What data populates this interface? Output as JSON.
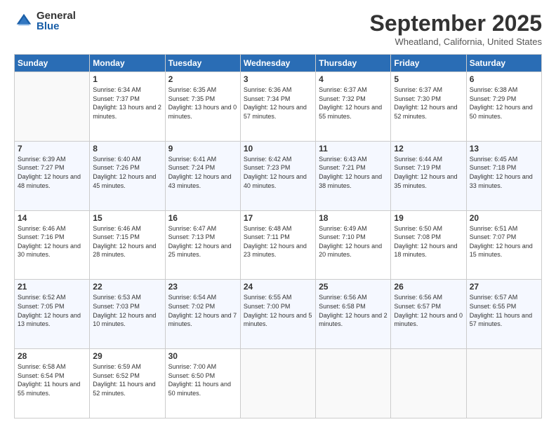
{
  "logo": {
    "general": "General",
    "blue": "Blue"
  },
  "header": {
    "month": "September 2025",
    "location": "Wheatland, California, United States"
  },
  "weekdays": [
    "Sunday",
    "Monday",
    "Tuesday",
    "Wednesday",
    "Thursday",
    "Friday",
    "Saturday"
  ],
  "weeks": [
    [
      {
        "day": "",
        "sunrise": "",
        "sunset": "",
        "daylight": ""
      },
      {
        "day": "1",
        "sunrise": "Sunrise: 6:34 AM",
        "sunset": "Sunset: 7:37 PM",
        "daylight": "Daylight: 13 hours and 2 minutes."
      },
      {
        "day": "2",
        "sunrise": "Sunrise: 6:35 AM",
        "sunset": "Sunset: 7:35 PM",
        "daylight": "Daylight: 13 hours and 0 minutes."
      },
      {
        "day": "3",
        "sunrise": "Sunrise: 6:36 AM",
        "sunset": "Sunset: 7:34 PM",
        "daylight": "Daylight: 12 hours and 57 minutes."
      },
      {
        "day": "4",
        "sunrise": "Sunrise: 6:37 AM",
        "sunset": "Sunset: 7:32 PM",
        "daylight": "Daylight: 12 hours and 55 minutes."
      },
      {
        "day": "5",
        "sunrise": "Sunrise: 6:37 AM",
        "sunset": "Sunset: 7:30 PM",
        "daylight": "Daylight: 12 hours and 52 minutes."
      },
      {
        "day": "6",
        "sunrise": "Sunrise: 6:38 AM",
        "sunset": "Sunset: 7:29 PM",
        "daylight": "Daylight: 12 hours and 50 minutes."
      }
    ],
    [
      {
        "day": "7",
        "sunrise": "Sunrise: 6:39 AM",
        "sunset": "Sunset: 7:27 PM",
        "daylight": "Daylight: 12 hours and 48 minutes."
      },
      {
        "day": "8",
        "sunrise": "Sunrise: 6:40 AM",
        "sunset": "Sunset: 7:26 PM",
        "daylight": "Daylight: 12 hours and 45 minutes."
      },
      {
        "day": "9",
        "sunrise": "Sunrise: 6:41 AM",
        "sunset": "Sunset: 7:24 PM",
        "daylight": "Daylight: 12 hours and 43 minutes."
      },
      {
        "day": "10",
        "sunrise": "Sunrise: 6:42 AM",
        "sunset": "Sunset: 7:23 PM",
        "daylight": "Daylight: 12 hours and 40 minutes."
      },
      {
        "day": "11",
        "sunrise": "Sunrise: 6:43 AM",
        "sunset": "Sunset: 7:21 PM",
        "daylight": "Daylight: 12 hours and 38 minutes."
      },
      {
        "day": "12",
        "sunrise": "Sunrise: 6:44 AM",
        "sunset": "Sunset: 7:19 PM",
        "daylight": "Daylight: 12 hours and 35 minutes."
      },
      {
        "day": "13",
        "sunrise": "Sunrise: 6:45 AM",
        "sunset": "Sunset: 7:18 PM",
        "daylight": "Daylight: 12 hours and 33 minutes."
      }
    ],
    [
      {
        "day": "14",
        "sunrise": "Sunrise: 6:46 AM",
        "sunset": "Sunset: 7:16 PM",
        "daylight": "Daylight: 12 hours and 30 minutes."
      },
      {
        "day": "15",
        "sunrise": "Sunrise: 6:46 AM",
        "sunset": "Sunset: 7:15 PM",
        "daylight": "Daylight: 12 hours and 28 minutes."
      },
      {
        "day": "16",
        "sunrise": "Sunrise: 6:47 AM",
        "sunset": "Sunset: 7:13 PM",
        "daylight": "Daylight: 12 hours and 25 minutes."
      },
      {
        "day": "17",
        "sunrise": "Sunrise: 6:48 AM",
        "sunset": "Sunset: 7:11 PM",
        "daylight": "Daylight: 12 hours and 23 minutes."
      },
      {
        "day": "18",
        "sunrise": "Sunrise: 6:49 AM",
        "sunset": "Sunset: 7:10 PM",
        "daylight": "Daylight: 12 hours and 20 minutes."
      },
      {
        "day": "19",
        "sunrise": "Sunrise: 6:50 AM",
        "sunset": "Sunset: 7:08 PM",
        "daylight": "Daylight: 12 hours and 18 minutes."
      },
      {
        "day": "20",
        "sunrise": "Sunrise: 6:51 AM",
        "sunset": "Sunset: 7:07 PM",
        "daylight": "Daylight: 12 hours and 15 minutes."
      }
    ],
    [
      {
        "day": "21",
        "sunrise": "Sunrise: 6:52 AM",
        "sunset": "Sunset: 7:05 PM",
        "daylight": "Daylight: 12 hours and 13 minutes."
      },
      {
        "day": "22",
        "sunrise": "Sunrise: 6:53 AM",
        "sunset": "Sunset: 7:03 PM",
        "daylight": "Daylight: 12 hours and 10 minutes."
      },
      {
        "day": "23",
        "sunrise": "Sunrise: 6:54 AM",
        "sunset": "Sunset: 7:02 PM",
        "daylight": "Daylight: 12 hours and 7 minutes."
      },
      {
        "day": "24",
        "sunrise": "Sunrise: 6:55 AM",
        "sunset": "Sunset: 7:00 PM",
        "daylight": "Daylight: 12 hours and 5 minutes."
      },
      {
        "day": "25",
        "sunrise": "Sunrise: 6:56 AM",
        "sunset": "Sunset: 6:58 PM",
        "daylight": "Daylight: 12 hours and 2 minutes."
      },
      {
        "day": "26",
        "sunrise": "Sunrise: 6:56 AM",
        "sunset": "Sunset: 6:57 PM",
        "daylight": "Daylight: 12 hours and 0 minutes."
      },
      {
        "day": "27",
        "sunrise": "Sunrise: 6:57 AM",
        "sunset": "Sunset: 6:55 PM",
        "daylight": "Daylight: 11 hours and 57 minutes."
      }
    ],
    [
      {
        "day": "28",
        "sunrise": "Sunrise: 6:58 AM",
        "sunset": "Sunset: 6:54 PM",
        "daylight": "Daylight: 11 hours and 55 minutes."
      },
      {
        "day": "29",
        "sunrise": "Sunrise: 6:59 AM",
        "sunset": "Sunset: 6:52 PM",
        "daylight": "Daylight: 11 hours and 52 minutes."
      },
      {
        "day": "30",
        "sunrise": "Sunrise: 7:00 AM",
        "sunset": "Sunset: 6:50 PM",
        "daylight": "Daylight: 11 hours and 50 minutes."
      },
      {
        "day": "",
        "sunrise": "",
        "sunset": "",
        "daylight": ""
      },
      {
        "day": "",
        "sunrise": "",
        "sunset": "",
        "daylight": ""
      },
      {
        "day": "",
        "sunrise": "",
        "sunset": "",
        "daylight": ""
      },
      {
        "day": "",
        "sunrise": "",
        "sunset": "",
        "daylight": ""
      }
    ]
  ]
}
